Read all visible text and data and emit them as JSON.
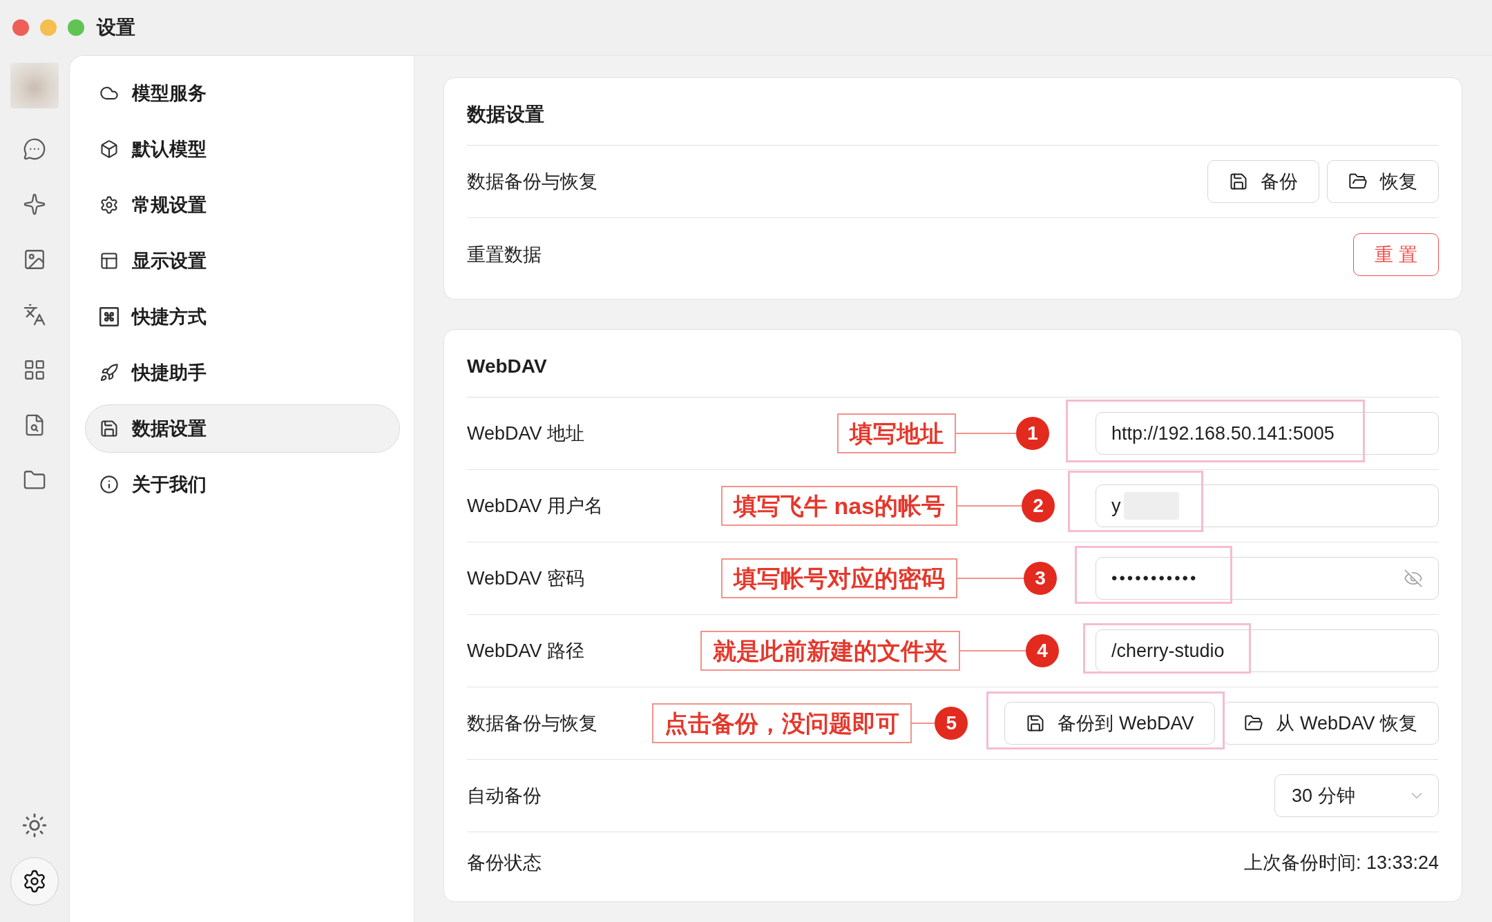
{
  "window": {
    "title": "设置"
  },
  "icon_bar": {
    "items": [
      {
        "selected": false
      },
      {
        "selected": false
      },
      {
        "selected": false
      },
      {
        "selected": false
      },
      {
        "selected": false
      },
      {
        "selected": false
      },
      {
        "selected": false
      }
    ],
    "settings_button": {
      "selected": true
    }
  },
  "nav": {
    "items": [
      {
        "label": "模型服务",
        "selected": false
      },
      {
        "label": "默认模型",
        "selected": false
      },
      {
        "label": "常规设置",
        "selected": false
      },
      {
        "label": "显示设置",
        "selected": false
      },
      {
        "label": "快捷方式",
        "selected": false
      },
      {
        "label": "快捷助手",
        "selected": false
      },
      {
        "label": "数据设置",
        "selected": true
      },
      {
        "label": "关于我们",
        "selected": false
      }
    ]
  },
  "data_settings": {
    "title": "数据设置",
    "rows": [
      {
        "label": "数据备份与恢复",
        "kind": "buttons",
        "buttons": [
          "备份",
          "恢复"
        ]
      },
      {
        "label": "重置数据",
        "kind": "danger_button",
        "button": "重 置"
      }
    ]
  },
  "webdav": {
    "title": "WebDAV",
    "rows": [
      {
        "label": "WebDAV 地址",
        "kind": "input",
        "value": "http://192.168.50.141:5005",
        "annotation": {
          "number": "1",
          "text": "填写地址"
        }
      },
      {
        "label": "WebDAV 用户名",
        "kind": "input",
        "value": "y",
        "redacted": true,
        "annotation": {
          "number": "2",
          "text": "填写飞牛 nas的帐号"
        }
      },
      {
        "label": "WebDAV 密码",
        "kind": "password",
        "value": "•••••••••••",
        "annotation": {
          "number": "3",
          "text": "填写帐号对应的密码"
        }
      },
      {
        "label": "WebDAV 路径",
        "kind": "input",
        "value": "/cherry-studio",
        "annotation": {
          "number": "4",
          "text": "就是此前新建的文件夹"
        }
      },
      {
        "label": "数据备份与恢复",
        "kind": "buttons",
        "buttons": [
          "备份到 WebDAV",
          "从 WebDAV 恢复"
        ],
        "annotation": {
          "number": "5",
          "text": "点击备份，没问题即可"
        }
      },
      {
        "label": "自动备份",
        "kind": "select",
        "value": "30 分钟"
      },
      {
        "label": "备份状态",
        "kind": "status",
        "value": "上次备份时间: 13:33:24"
      }
    ]
  }
}
